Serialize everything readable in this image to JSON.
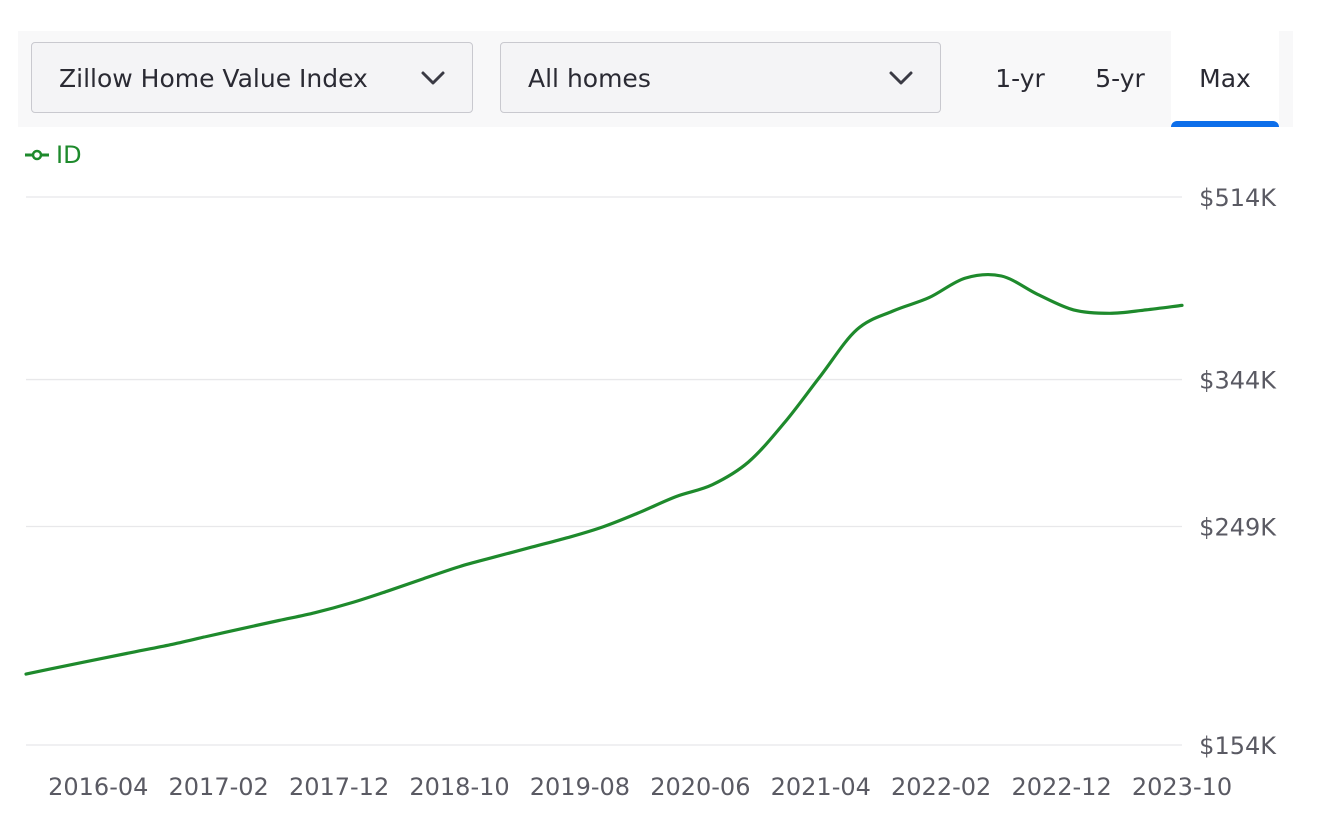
{
  "controls": {
    "metric_select": {
      "value": "Zillow Home Value Index",
      "icon": "chevron-down-icon"
    },
    "home_type_select": {
      "value": "All homes",
      "icon": "chevron-down-icon"
    },
    "range_tabs": [
      {
        "label": "1-yr",
        "active": false
      },
      {
        "label": "5-yr",
        "active": false
      },
      {
        "label": "Max",
        "active": true
      }
    ]
  },
  "colors": {
    "series": "#1e8a2c",
    "active_tab": "#0d6eea",
    "grid": "#e8e8ea"
  },
  "chart_data": {
    "type": "line",
    "title": "",
    "xlabel": "",
    "ylabel": "",
    "y_ticks": [
      154000,
      249000,
      344000,
      514000
    ],
    "y_tick_labels": [
      "$154K",
      "$249K",
      "$344K",
      "$514K"
    ],
    "ylim": [
      154000,
      514000
    ],
    "y_scale": "log",
    "x_tick_labels": [
      "2016-04",
      "2017-02",
      "2017-12",
      "2018-10",
      "2019-08",
      "2020-06",
      "2021-04",
      "2022-02",
      "2022-12",
      "2023-10"
    ],
    "xlim": [
      "2015-10",
      "2023-10"
    ],
    "grid": true,
    "legend": "top-left",
    "series": [
      {
        "name": "ID",
        "x": [
          "2015-10",
          "2016-01",
          "2016-04",
          "2016-07",
          "2016-10",
          "2017-01",
          "2017-04",
          "2017-07",
          "2017-10",
          "2018-01",
          "2018-04",
          "2018-07",
          "2018-10",
          "2019-01",
          "2019-04",
          "2019-07",
          "2019-10",
          "2020-01",
          "2020-04",
          "2020-07",
          "2020-10",
          "2021-01",
          "2021-04",
          "2021-07",
          "2021-10",
          "2022-01",
          "2022-04",
          "2022-07",
          "2022-10",
          "2023-01",
          "2023-04",
          "2023-07",
          "2023-10"
        ],
        "y": [
          180000,
          183000,
          186000,
          189000,
          192000,
          195500,
          199000,
          202500,
          206000,
          210500,
          216000,
          222000,
          228000,
          233000,
          238000,
          243000,
          249000,
          257000,
          266000,
          273000,
          287000,
          313000,
          347000,
          384000,
          400000,
          412000,
          430000,
          432000,
          415000,
          401000,
          398000,
          401000,
          405000
        ]
      }
    ]
  }
}
